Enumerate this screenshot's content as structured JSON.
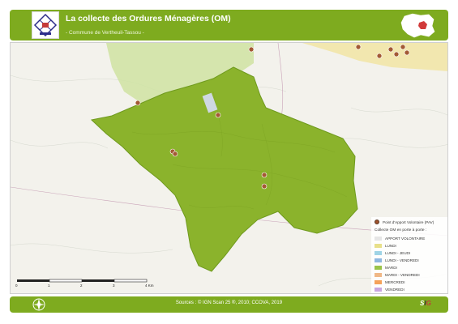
{
  "header": {
    "title": "La collecte des Ordures Ménagères (OM)",
    "subtitle": "- Commune de Vertheuil-Tassou -"
  },
  "map": {
    "colors": {
      "commune_fill": "#8bb32c",
      "neighbor_fill": "#cfe3a2",
      "neighbor_yellow": "#f2e6a8",
      "background": "#f3f2ec",
      "point_fill": "#a35a34"
    },
    "markers": "Point d'Apport Volontaire (PAV)"
  },
  "legend": {
    "pav_label": "Point d'Apport Volontaire (PAV)",
    "collection_title": "Collecte OM en porte à porte :",
    "items": [
      {
        "label": "APPORT VOLONTAIRE",
        "color": "#e6e6e6"
      },
      {
        "label": "LUNDI",
        "color": "#e8e08a"
      },
      {
        "label": "LUNDI - JEUDI",
        "color": "#9fd4e6"
      },
      {
        "label": "LUNDI - VENDREDI",
        "color": "#8fb8e0"
      },
      {
        "label": "MARDI",
        "color": "#9ac44a"
      },
      {
        "label": "MARDI - VENDREDI",
        "color": "#f0b887"
      },
      {
        "label": "MERCREDI",
        "color": "#f5a25a"
      },
      {
        "label": "VENDREDI",
        "color": "#c9a6e0"
      }
    ]
  },
  "scale": {
    "ticks": [
      "0",
      "1",
      "2",
      "3",
      "4 Km"
    ]
  },
  "footer": {
    "sources": "Sources : © IGN Scan 25 ®, 2010; CCOVA, 2019",
    "brand_1": "S",
    "brand_2": "I",
    "brand_3": "G"
  }
}
